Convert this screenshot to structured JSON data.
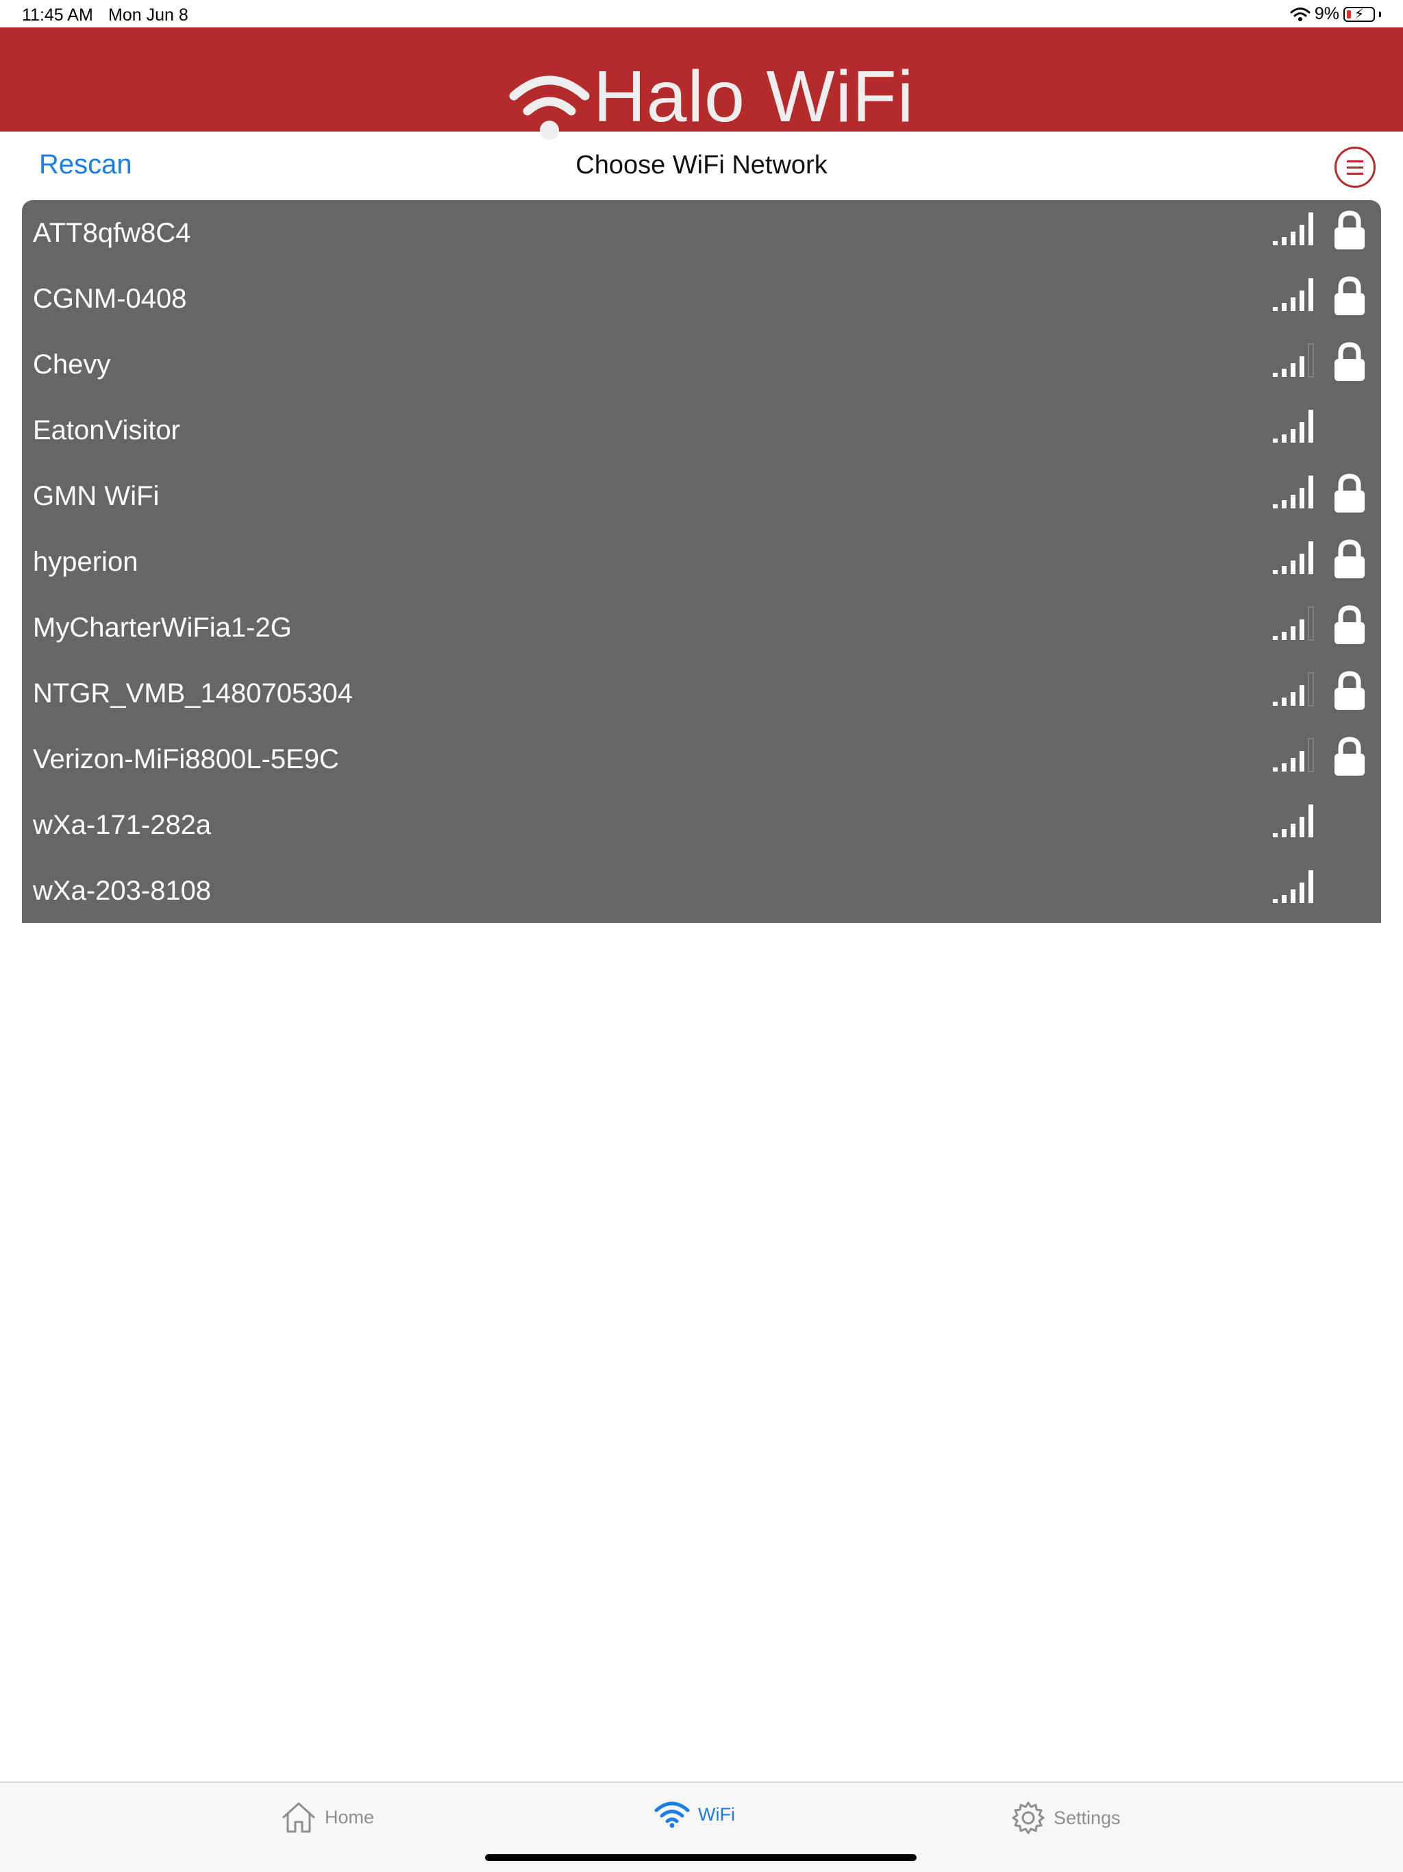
{
  "status_bar": {
    "time": "11:45 AM",
    "date": "Mon Jun 8",
    "battery_percent": "9%",
    "battery_level": 0.09,
    "icons": [
      "wifi-icon",
      "battery-icon",
      "charging-bolt-icon"
    ]
  },
  "banner": {
    "title": "Halo WiFi",
    "logo_icon": "wifi-logo-icon",
    "background_color": "#b52a2b",
    "text_color": "#eeeeee"
  },
  "nav": {
    "rescan_label": "Rescan",
    "title": "Choose WiFi Network",
    "menu_icon": "hamburger-menu-icon",
    "accent_color": "#1a7ee6"
  },
  "networks": [
    {
      "name": "ATT8qfw8C4",
      "signal_bars": 5,
      "locked": true
    },
    {
      "name": "CGNM-0408",
      "signal_bars": 5,
      "locked": true
    },
    {
      "name": "Chevy",
      "signal_bars": 4,
      "locked": true
    },
    {
      "name": "EatonVisitor",
      "signal_bars": 5,
      "locked": false
    },
    {
      "name": "GMN WiFi",
      "signal_bars": 5,
      "locked": true
    },
    {
      "name": "hyperion",
      "signal_bars": 5,
      "locked": true
    },
    {
      "name": "MyCharterWiFia1-2G",
      "signal_bars": 4,
      "locked": true
    },
    {
      "name": "NTGR_VMB_1480705304",
      "signal_bars": 4,
      "locked": true
    },
    {
      "name": "Verizon-MiFi8800L-5E9C",
      "signal_bars": 4,
      "locked": true
    },
    {
      "name": "wXa-171-282a",
      "signal_bars": 5,
      "locked": false
    },
    {
      "name": "wXa-203-8108",
      "signal_bars": 5,
      "locked": false
    }
  ],
  "tab_bar": {
    "tabs": [
      {
        "label": "Home",
        "icon": "home-icon",
        "active": false
      },
      {
        "label": "WiFi",
        "icon": "wifi-icon",
        "active": true
      },
      {
        "label": "Settings",
        "icon": "gear-icon",
        "active": false
      }
    ],
    "active_color": "#1a7ee6",
    "inactive_color": "#8e8e93"
  }
}
